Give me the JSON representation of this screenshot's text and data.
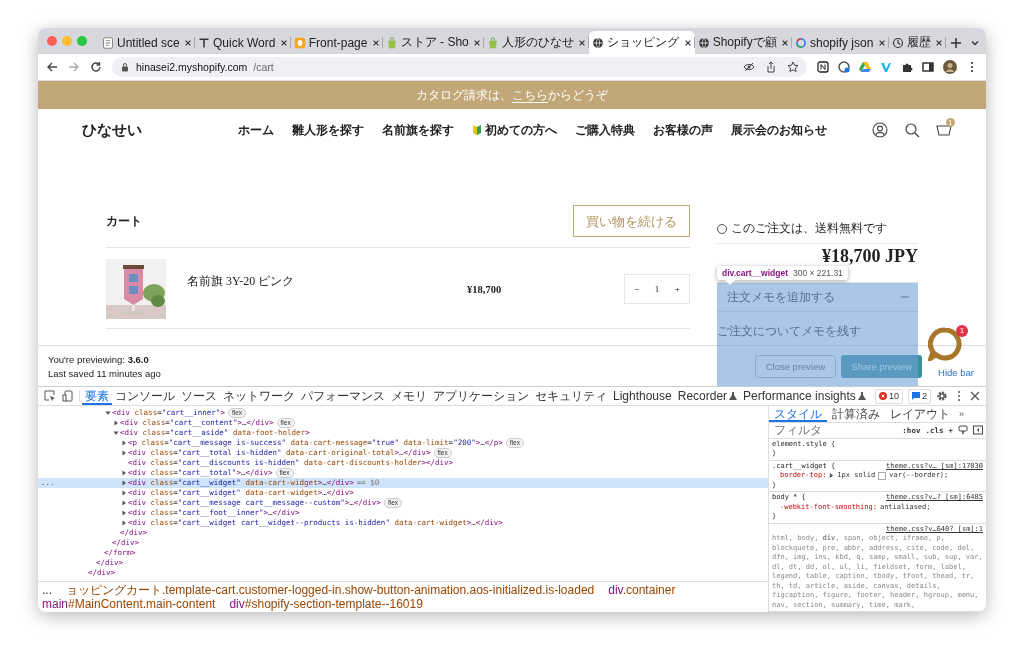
{
  "browser": {
    "tabs": [
      {
        "title": "Untitled sce",
        "selected": false
      },
      {
        "title": "Quick Word",
        "selected": false
      },
      {
        "title": "Front-page",
        "selected": false
      },
      {
        "title": "ストア - Sho",
        "selected": false
      },
      {
        "title": "人形のひなせ",
        "selected": false
      },
      {
        "title": "ショッピング",
        "selected": true
      },
      {
        "title": "Shopifyで顧",
        "selected": false
      },
      {
        "title": "shopify json",
        "selected": false
      },
      {
        "title": "履歴",
        "selected": false
      }
    ],
    "address": {
      "host": "hinasei2.myshopify.com",
      "path": "/cart"
    }
  },
  "page": {
    "announcement": {
      "before": "カタログ請求は、",
      "link": "こちら",
      "after": "からどうぞ"
    },
    "logo": "ひなせい",
    "nav": [
      {
        "label": "ホーム",
        "kind": "plain"
      },
      {
        "label": "雛人形を探す",
        "kind": "plain"
      },
      {
        "label": "名前旗を探す",
        "kind": "plain"
      },
      {
        "label": "初めての方へ",
        "kind": "marked"
      },
      {
        "label": "ご購入特典",
        "kind": "plain"
      },
      {
        "label": "お客様の声",
        "kind": "plain"
      },
      {
        "label": "展示会のお知らせ",
        "kind": "plain"
      }
    ],
    "cart_count": "1",
    "cart": {
      "title": "カート",
      "continue_button": "買い物を続ける",
      "items": [
        {
          "name": "名前旗 3Y-20 ピンク",
          "price": "¥18,700",
          "quantity": "1",
          "minus": "−",
          "plus": "+"
        }
      ],
      "shipping_note": "このご注文は、送料無料です",
      "total": "¥18,700 JPY",
      "memo_toggle": "注文メモを追加する",
      "memo_expanded": true,
      "memo_placeholder": "ご注文についてメモを残す"
    },
    "inspector_tooltip": {
      "selector": "div.cart__widget",
      "size": "300 × 221.31"
    },
    "preview": {
      "label": "You're previewing: **3.6.0**",
      "saved": "Last saved 11 minutes ago",
      "close": "Close preview",
      "share": "Share preview",
      "hide": "Hide bar"
    },
    "chat_badge": "1"
  },
  "devtools": {
    "tabs": [
      {
        "label": "要素",
        "selected": true,
        "kind": "plain"
      },
      {
        "label": "コンソール",
        "selected": false,
        "kind": "plain"
      },
      {
        "label": "ソース",
        "selected": false,
        "kind": "plain"
      },
      {
        "label": "ネットワーク",
        "selected": false,
        "kind": "plain"
      },
      {
        "label": "パフォーマンス",
        "selected": false,
        "kind": "plain"
      },
      {
        "label": "メモリ",
        "selected": false,
        "kind": "plain"
      },
      {
        "label": "アプリケーション",
        "selected": false,
        "kind": "plain"
      },
      {
        "label": "セキュリティ",
        "selected": false,
        "kind": "plain"
      },
      {
        "label": "Lighthouse",
        "selected": false,
        "kind": "plain"
      },
      {
        "label": "Recorder",
        "selected": false,
        "kind": "experimental"
      },
      {
        "label": "Performance insights",
        "selected": false,
        "kind": "experimental"
      }
    ],
    "errors": "10",
    "messages": "2",
    "tree": [
      {
        "closing": "</div>",
        "children": [
          {
            "closing": "</div>",
            "children": [
              {
                "closing": "</form>",
                "children": [
                  {
                    "markup": "<div class=\"cart__inner\">",
                    "expandable": true,
                    "expanded": true,
                    "badge": "flex",
                    "selected": false,
                    "closing": "</div>",
                    "children": [
                      {
                        "markup": "<div class=\"cart__content\">…</div>",
                        "expandable": true,
                        "expanded": false,
                        "badge": "flex",
                        "selected": false
                      },
                      {
                        "markup": "<div class=\"cart__aside\" data-foot-holder>",
                        "expandable": true,
                        "expanded": true,
                        "selected": false,
                        "closing": "</div>",
                        "children": [
                          {
                            "markup": "<p class=\"cart__message is-success\" data-cart-message=\"true\" data-limit=\"200\">…</p>",
                            "expandable": true,
                            "expanded": false,
                            "badge": "flex",
                            "selected": false
                          },
                          {
                            "markup": "<div class=\"cart__total is-hidden\" data-cart-original-total>…</div>",
                            "expandable": true,
                            "expanded": false,
                            "badge": "flex",
                            "selected": false
                          },
                          {
                            "markup": "<div class=\"cart__discounts is-hidden\" data-cart-discounts-holder></div>",
                            "expandable": false,
                            "selected": false
                          },
                          {
                            "markup": "<div class=\"cart__total\">…</div>",
                            "expandable": true,
                            "expanded": false,
                            "badge": "flex",
                            "selected": false
                          },
                          {
                            "markup": "<div class=\"cart__widget\" data-cart-widget>…</div>",
                            "expandable": true,
                            "expanded": false,
                            "selected": true,
                            "gutter": "...",
                            "suffix": "== $0"
                          },
                          {
                            "markup": "<div class=\"cart__widget\" data-cart-widget>…</div>",
                            "expandable": true,
                            "expanded": false,
                            "selected": false
                          },
                          {
                            "markup": "<div class=\"cart__message cart__message--custom\">…</div>",
                            "expandable": true,
                            "expanded": false,
                            "badge": "flex",
                            "selected": false
                          },
                          {
                            "markup": "<div class=\"cart__foot__inner\">…</div>",
                            "expandable": true,
                            "expanded": false,
                            "selected": false
                          },
                          {
                            "markup": "<div class=\"cart__widget cart__widget--products is-hidden\" data-cart-widget>…</div>",
                            "expandable": true,
                            "expanded": false,
                            "selected": false
                          }
                        ]
                      }
                    ]
                  }
                ]
              }
            ]
          }
        ]
      }
    ],
    "breadcrumbs": [
      {
        "text": "...",
        "kind": "more"
      },
      {
        "text": "ョッピングカート.template-cart.customer-logged-in.show-button-animation.aos-initialized.is-loaded",
        "kind": "crumb"
      },
      {
        "text": "div.container",
        "kind": "crumb"
      },
      {
        "text": "main#MainContent.main-content",
        "kind": "crumb"
      },
      {
        "text": "div#shopify-section-template--16019",
        "kind": "crumb"
      }
    ],
    "styles": {
      "tabs": [
        {
          "label": "スタイル",
          "selected": true
        },
        {
          "label": "計算済み",
          "selected": false
        },
        {
          "label": "レイアウト",
          "selected": false
        }
      ],
      "more": "»",
      "filter_placeholder": "フィルタ",
      "buttons": [
        ":hov",
        ".cls",
        "+"
      ],
      "rules": [
        {
          "selector": "element.style {",
          "close": "}"
        },
        {
          "selector": ".cart__widget {",
          "source": "theme.css?v… [sm]:17830",
          "declarations": [
            {
              "property": "border-top:",
              "expandable": true,
              "value": "1px solid",
              "swatch": true,
              "value_after": "var(--border);"
            }
          ],
          "close": "}"
        },
        {
          "selector": "body * {",
          "source": "theme.css?v…? [sm]:6485",
          "declarations": [
            {
              "property": "-webkit-font-smoothing:",
              "expandable": false,
              "value": "antialiased;",
              "swatch": false
            }
          ],
          "close": "}"
        },
        {
          "selector": "html, body, **div**, span, object, iframe, p, blockquote, pre, abbr, address, cite, code, del, dfn, img, ins, kbd, q, samp, small, sub, sup, var, dl, dt, dd, ol, ul, li, fieldset, form, label, legend, table, caption, tbody, tfoot, thead, tr, th, td, article, aside, canvas, details, figcaption, figure, footer, header, hgroup, menu, nav, section, summary, time, mark,",
          "source": "theme.css?v…640? [sm]:1"
        }
      ]
    }
  }
}
